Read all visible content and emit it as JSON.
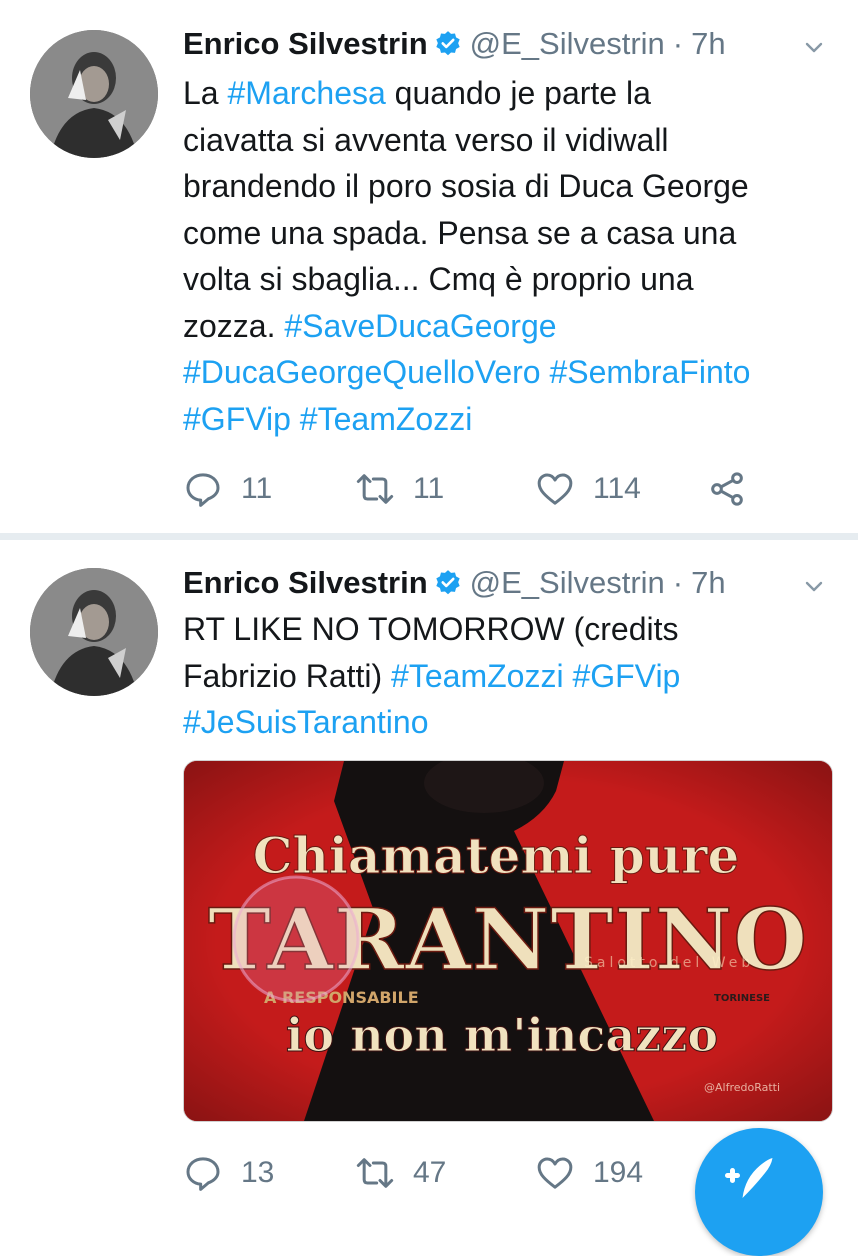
{
  "tweets": [
    {
      "author_name": "Enrico Silvestrin",
      "handle": "@E_Silvestrin",
      "separator": "·",
      "time": "7h",
      "lines": [
        {
          "parts": [
            {
              "text": "La "
            },
            {
              "text": "#Marchesa",
              "hashtag": true
            },
            {
              "text": " quando je parte la"
            }
          ]
        },
        {
          "parts": [
            {
              "text": "ciavatta si avventa verso il vidiwall"
            }
          ]
        },
        {
          "parts": [
            {
              "text": "brandendo il poro sosia di Duca George"
            }
          ]
        },
        {
          "parts": [
            {
              "text": "come una spada. Pensa se a casa una"
            }
          ]
        },
        {
          "parts": [
            {
              "text": "volta si sbaglia... Cmq è proprio una"
            }
          ]
        },
        {
          "parts": [
            {
              "text": "zozza. "
            },
            {
              "text": "#SaveDucaGeorge",
              "hashtag": true
            }
          ]
        },
        {
          "parts": [
            {
              "text": "#DucaGeorgeQuelloVero",
              "hashtag": true
            },
            {
              "text": " "
            },
            {
              "text": "#SembraFinto",
              "hashtag": true
            }
          ]
        },
        {
          "parts": [
            {
              "text": "#GFVip",
              "hashtag": true
            },
            {
              "text": " "
            },
            {
              "text": "#TeamZozzi",
              "hashtag": true
            }
          ]
        }
      ],
      "replies": "11",
      "retweets": "11",
      "likes": "114"
    },
    {
      "author_name": "Enrico Silvestrin",
      "handle": "@E_Silvestrin",
      "separator": "·",
      "time": "7h",
      "lines": [
        {
          "parts": [
            {
              "text": "RT LIKE NO TOMORROW (credits"
            }
          ]
        },
        {
          "parts": [
            {
              "text": "Fabrizio Ratti) "
            },
            {
              "text": "#TeamZozzi",
              "hashtag": true
            },
            {
              "text": " "
            },
            {
              "text": "#GFVip",
              "hashtag": true
            }
          ]
        },
        {
          "parts": [
            {
              "text": "#JeSuisTarantino",
              "hashtag": true
            }
          ]
        }
      ],
      "media": {
        "line1": "Chiamatemi pure",
        "line2": "TARANTINO",
        "small_left": "A RESPONSABILE",
        "small_right": "TORINESE",
        "line3": "io non m'incazzo",
        "credit": "@AlfredoRatti",
        "watermark": "Salotto del Web"
      },
      "replies": "13",
      "retweets": "47",
      "likes": "194"
    }
  ],
  "colors": {
    "hashtag": "#1da1f2",
    "muted": "#657786",
    "poster_red": "#c01a1a",
    "fab": "#1da1f2"
  },
  "icons": {
    "reply": "reply-icon",
    "retweet": "retweet-icon",
    "like": "heart-icon",
    "share": "share-icon",
    "verified": "verified-badge-icon",
    "caret": "chevron-down-icon",
    "compose": "compose-tweet-icon"
  }
}
